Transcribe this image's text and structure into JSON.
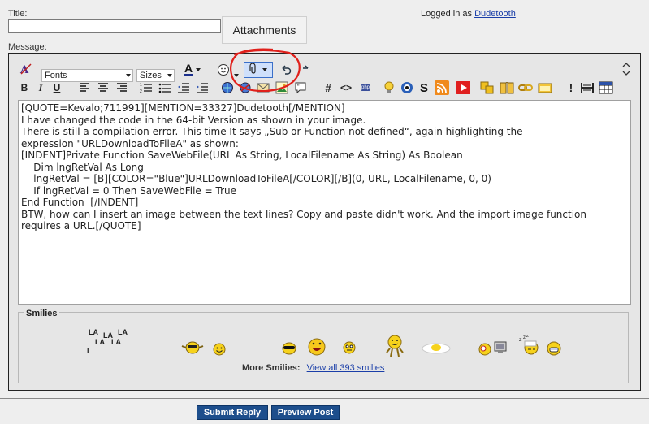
{
  "form": {
    "title_label": "Title:",
    "message_label": "Message:",
    "title_value": ""
  },
  "login": {
    "prefix": "Logged in as",
    "username": "Dudetooth"
  },
  "tooltip": {
    "text": "Attachments"
  },
  "toolbar": {
    "font_select": "Fonts",
    "size_select": "Sizes",
    "font_color_glyph": "A",
    "bold": "B",
    "italic": "I",
    "underline": "U",
    "code_hash": "#",
    "html_tag": "<>",
    "php": "php",
    "highlight_s": "S"
  },
  "editor": {
    "lines": [
      "[QUOTE=Kevalo;711991][MENTION=33327]Dudetooth[/MENTION]",
      "",
      "I have changed the code in the 64-bit Version as shown in your image.",
      "",
      "There is still a compilation error. This time It says „Sub or Function not defined“, again highlighting the",
      "expression \"URLDownloadToFileA\" as shown:",
      "",
      "[INDENT]Private Function SaveWebFile(URL As String, LocalFilename As String) As Boolean",
      "    Dim lngRetVal As Long",
      "    lngRetVal = [B][COLOR=\"Blue\"]URLDownloadToFileA[/COLOR][/B](0, URL, LocalFilename, 0, 0)",
      "    If lngRetVal = 0 Then SaveWebFile = True",
      "End Function  [/INDENT]",
      "",
      "BTW, how can I insert an image between the text lines? Copy and paste didn't work. And the import image function",
      "requires a URL.[/QUOTE]"
    ]
  },
  "smilies": {
    "legend": "Smilies",
    "lalala": [
      "LA",
      "LA",
      "LA",
      "LA",
      "LA",
      "l"
    ],
    "more_label": "More Smilies:",
    "view_all": "View all 393 smilies"
  },
  "buttons": {
    "submit": "Submit Reply",
    "preview": "Preview Post"
  },
  "colors": {
    "accent": "#1d4e8c",
    "link": "#1a3ea8",
    "highlight_circle": "#e0201b"
  }
}
